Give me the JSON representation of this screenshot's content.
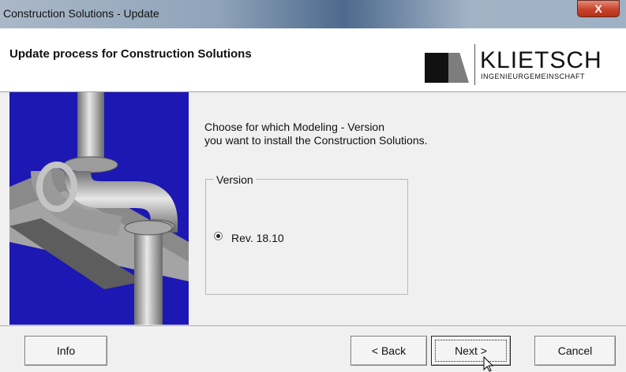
{
  "window": {
    "title": "Construction Solutions - Update",
    "close_label": "X"
  },
  "header": {
    "title": "Update process for Construction Solutions",
    "logo": {
      "name": "KLIETSCH",
      "subtitle": "INGENIEURGEMEINSCHAFT"
    }
  },
  "main": {
    "instruction_line1": "Choose for which Modeling - Version",
    "instruction_line2": "you want to install the Construction Solutions.",
    "group_label": "Version",
    "option_label": "Rev. 18.10",
    "option_selected": true
  },
  "buttons": {
    "info": "Info",
    "back": "< Back",
    "next": "Next >",
    "cancel": "Cancel"
  },
  "colors": {
    "side_image_bg": "#1d18b3",
    "pipe": "#b8b8b8",
    "title_close": "#c8432b"
  },
  "icons": {
    "cursor": "mouse-pointer-icon"
  }
}
